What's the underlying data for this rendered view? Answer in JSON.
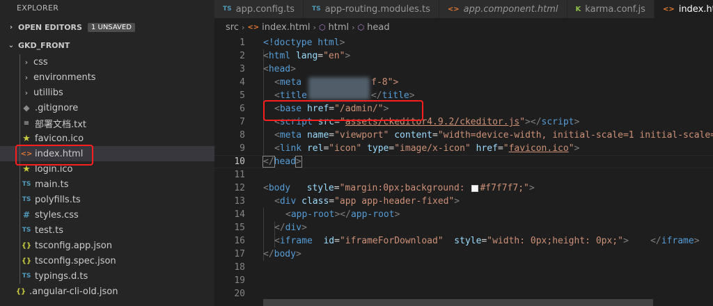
{
  "sidebar": {
    "title": "EXPLORER",
    "open_editors": {
      "label": "OPEN EDITORS",
      "badge": "1 UNSAVED"
    },
    "project": {
      "label": "GKD_FRONT"
    },
    "items": [
      {
        "label": "css",
        "type": "folder"
      },
      {
        "label": "environments",
        "type": "folder"
      },
      {
        "label": "utillibs",
        "type": "folder"
      },
      {
        "label": ".gitignore",
        "type": "git"
      },
      {
        "label": "部署文档.txt",
        "type": "txt"
      },
      {
        "label": "favicon.ico",
        "type": "star"
      },
      {
        "label": "index.html",
        "type": "html"
      },
      {
        "label": "login.ico",
        "type": "star"
      },
      {
        "label": "main.ts",
        "type": "ts"
      },
      {
        "label": "polyfills.ts",
        "type": "ts"
      },
      {
        "label": "styles.css",
        "type": "hash"
      },
      {
        "label": "test.ts",
        "type": "ts"
      },
      {
        "label": "tsconfig.app.json",
        "type": "json"
      },
      {
        "label": "tsconfig.spec.json",
        "type": "json"
      },
      {
        "label": "typings.d.ts",
        "type": "ts"
      },
      {
        "label": ".angular-cli-old.json",
        "type": "json"
      }
    ]
  },
  "tabs": [
    {
      "label": "app.config.ts",
      "icon": "TS"
    },
    {
      "label": "app-routing.modules.ts",
      "icon": "TS"
    },
    {
      "label": "app.component.html",
      "icon": "<>"
    },
    {
      "label": "karma.conf.js",
      "icon": "K"
    },
    {
      "label": "index.html",
      "icon": "<>"
    }
  ],
  "breadcrumb": {
    "root": "src",
    "file": "index.html",
    "node1": "html",
    "node2": "head"
  },
  "icons": {
    "ts": "TS",
    "json": "{}",
    "html": "<>",
    "hash": "#",
    "star": "★",
    "git": "◆",
    "txt": "≡",
    "chev_right": "›",
    "chev_down": "⌄"
  },
  "code": {
    "l1": {
      "a": "<!doctype ",
      "b": "html",
      "c": ">"
    },
    "l2": {
      "a": "<",
      "b": "html",
      "c": " lang",
      "d": "=",
      "e": "\"en\"",
      "f": ">"
    },
    "l3": {
      "a": "<",
      "b": "head",
      "c": ">"
    },
    "l4": {
      "a": "<",
      "b": "meta",
      "c": "f-8\">"
    },
    "l5": {
      "a": "<",
      "b": "title",
      "c": "</",
      "d": "title",
      "e": ">"
    },
    "l6": {
      "a": "<",
      "b": "base",
      "c": " href",
      "d": "=",
      "e": "\"/admin/\"",
      "f": ">"
    },
    "l7": {
      "a": "<",
      "b": "script",
      "c": " src",
      "d": "=",
      "e": "\"",
      "f": "assets/ckeditor4.9.2/ckeditor.js",
      "g": "\"",
      "h": "></",
      "i": "script",
      "j": ">"
    },
    "l8": {
      "a": "<",
      "b": "meta",
      "c": " name",
      "d": "=",
      "e": "\"viewport\"",
      "f": " content",
      "g": "=",
      "h": "\"width=device-width, initial-scale=1 initial-scale="
    },
    "l9": {
      "a": "<",
      "b": "link",
      "c": " rel",
      "d": "=",
      "e": "\"icon\"",
      "f": " type",
      "g": "=",
      "h": "\"image/x-icon\"",
      "i": " href",
      "j": "=",
      "k": "\"",
      "l": "favicon.ico",
      "m": "\"",
      "n": ">"
    },
    "l10": {
      "a": "</",
      "b": "head",
      "c": ">"
    },
    "l12": {
      "a": "<",
      "b": "body",
      "c": "   style",
      "d": "=",
      "e": "\"margin:0px;background: ",
      "f": "#f7f7f7;\"",
      "g": ">"
    },
    "l13": {
      "a": "<",
      "b": "div",
      "c": " class",
      "d": "=",
      "e": "\"app app-header-fixed\"",
      "f": ">"
    },
    "l14": {
      "a": "<",
      "b": "app-root",
      "c": "></",
      "d": "app-root",
      "e": ">"
    },
    "l15": {
      "a": "</",
      "b": "div",
      "c": ">"
    },
    "l16": {
      "a": "<",
      "b": "iframe",
      "c": "  id",
      "d": "=",
      "e": "\"iframeForDownload\"",
      "f": "  style",
      "g": "=",
      "h": "\"width: 0px;height: 0px;\"",
      "i": ">    </",
      "j": "iframe",
      "k": ">"
    },
    "l17": {
      "a": "</",
      "b": "body",
      "c": ">"
    },
    "line_numbers": [
      "1",
      "2",
      "3",
      "4",
      "5",
      "6",
      "7",
      "8",
      "9",
      "10",
      "11",
      "12",
      "13",
      "14",
      "15",
      "16",
      "17",
      "18",
      "19",
      "20"
    ]
  }
}
